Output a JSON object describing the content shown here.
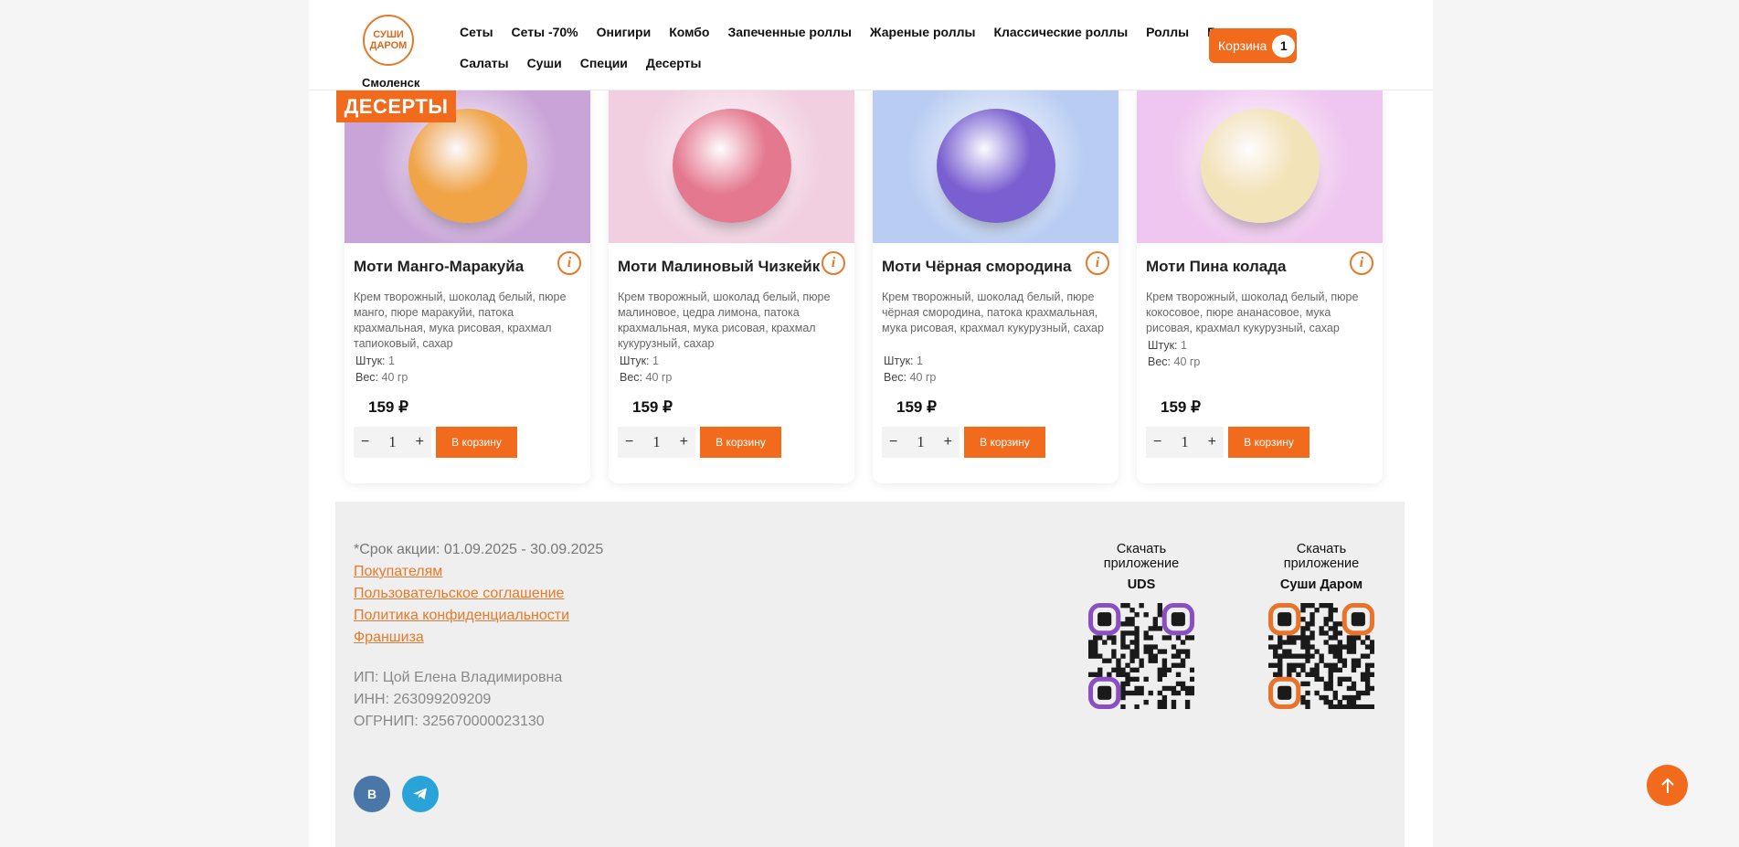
{
  "header": {
    "logo_line1": "СУШИ",
    "logo_line2": "ДАРОМ",
    "city": "Смоленск",
    "nav_row1": [
      "Сеты",
      "Сеты -70%",
      "Онигири",
      "Комбо",
      "Запеченные роллы",
      "Жареные роллы",
      "Классические роллы",
      "Роллы",
      "Гарниры"
    ],
    "nav_row2": [
      "Салаты",
      "Суши",
      "Специи",
      "Десерты"
    ],
    "cart_label": "Корзина",
    "cart_count": "1"
  },
  "section_tag": "ДЕСЕРТЫ",
  "products": [
    {
      "title": "Моти Манго-Маракуйа",
      "desc": "Крем творожный, шоколад белый, пюре манго, пюре маракуйи, патока крахмальная, мука рисовая, крахмал тапиоковый, сахар",
      "pieces_label": "Штук:",
      "pieces": "1",
      "weight_label": "Вес:",
      "weight": "40 гр",
      "price": "159 ₽",
      "qty": "1",
      "add_label": "В корзину",
      "bg": "#c9a4d8",
      "ball": "#f0a445"
    },
    {
      "title": "Моти Малиновый Чизкейк",
      "desc": "Крем творожный, шоколад белый, пюре малиновое, цедра лимона, патока крахмальная, мука рисовая, крахмал кукурузный, сахар",
      "pieces_label": "Штук:",
      "pieces": "1",
      "weight_label": "Вес:",
      "weight": "40 гр",
      "price": "159 ₽",
      "qty": "1",
      "add_label": "В корзину",
      "bg": "#f1cfe0",
      "ball": "#e4788f"
    },
    {
      "title": "Моти Чёрная смородина",
      "desc": "Крем творожный, шоколад белый, пюре чёрная смородина, патока крахмальная, мука рисовая, крахмал кукурузный, сахар",
      "pieces_label": "Штук:",
      "pieces": "1",
      "weight_label": "Вес:",
      "weight": "40 гр",
      "price": "159 ₽",
      "qty": "1",
      "add_label": "В корзину",
      "bg": "#b9cdf2",
      "ball": "#7a5fd0"
    },
    {
      "title": "Моти Пина колада",
      "desc": "Крем творожный, шоколад белый, пюре кокосовое, пюре ананасовое, мука рисовая, крахмал кукурузный, сахар",
      "pieces_label": "Штук:",
      "pieces": "1",
      "weight_label": "Вес:",
      "weight": "40 гр",
      "price": "159 ₽",
      "qty": "1",
      "add_label": "В корзину",
      "bg": "#efc6ef",
      "ball": "#f3e3b8"
    }
  ],
  "footer": {
    "promo": "*Срок акции: 01.09.2025 - 30.09.2025",
    "links": [
      "Покупателям",
      "Пользовательское соглашение",
      "Политика конфиденциальности",
      "Франшиза"
    ],
    "requisites": [
      "ИП: Цой Елена Владимировна",
      "ИНН: 263099209209",
      "ОГРНИП: 325670000023130"
    ],
    "qr1_line1": "Скачать приложение",
    "qr1_line2": "UDS",
    "qr2_line1": "Скачать приложение",
    "qr2_line2": "Суши Даром",
    "vk_label": "B"
  },
  "colors": {
    "accent": "#f26b1d",
    "qr1_corner": "#8a4fc0",
    "qr2_corner": "#e8732a",
    "vk": "#4a76a8",
    "telegram": "#2aa3d8"
  }
}
